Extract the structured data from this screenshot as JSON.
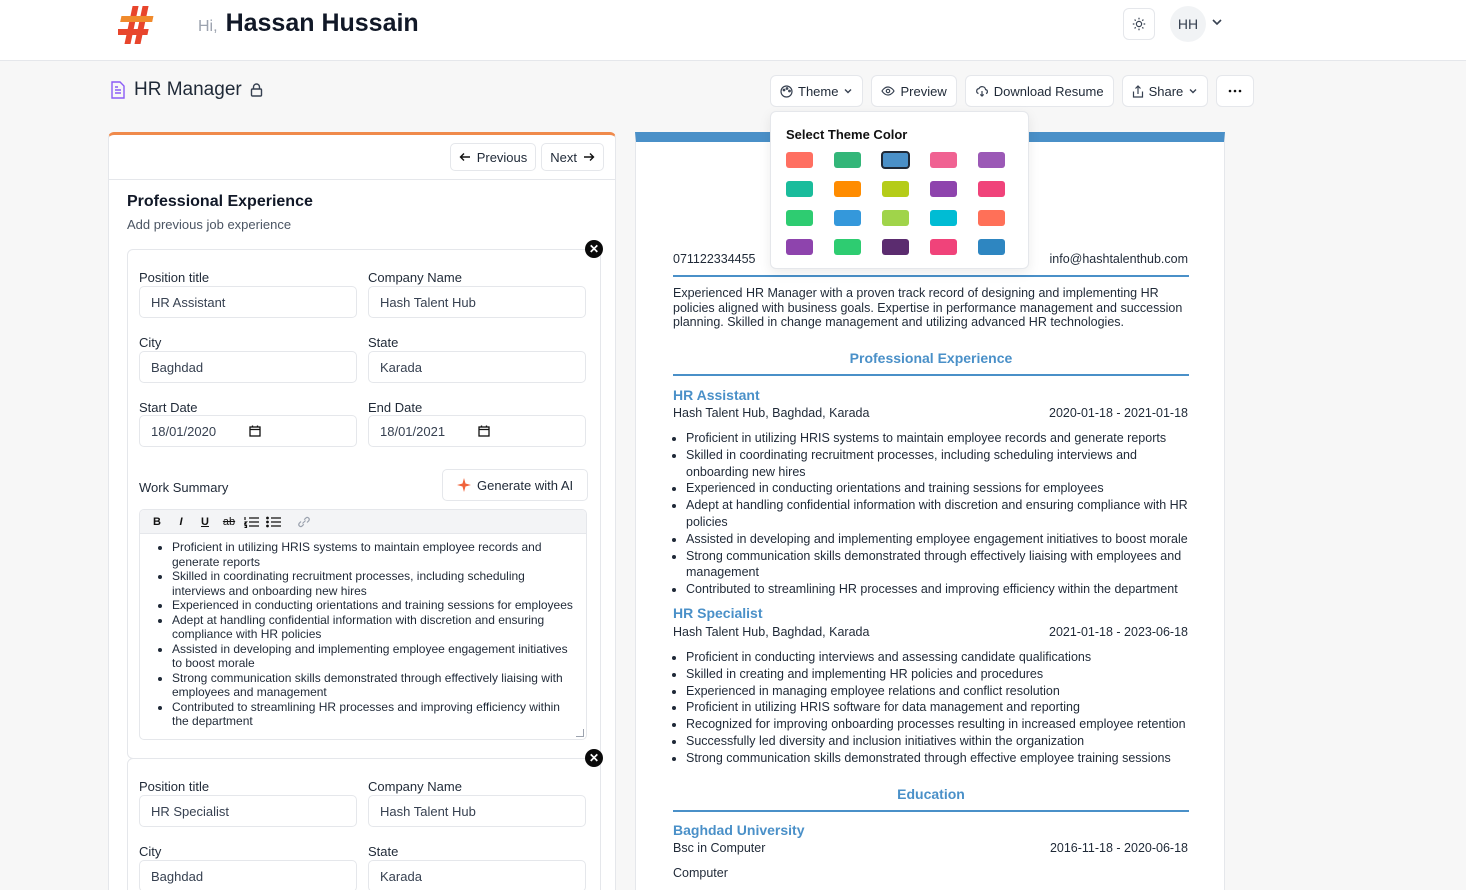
{
  "header": {
    "greeting": "Hi,",
    "user_name": "Hassan Hussain",
    "avatar_initials": "HH",
    "theme_toggle_icon": "sun-icon",
    "logo_icon": "hash-logo"
  },
  "document": {
    "title": "HR Manager",
    "lock_icon": "lock-icon"
  },
  "toolbar": {
    "theme": "Theme",
    "preview": "Preview",
    "download": "Download Resume",
    "share": "Share",
    "more_icon": "ellipsis-icon"
  },
  "theme_dropdown": {
    "title": "Select Theme Color",
    "colors": [
      "#ff6f61",
      "#33b679",
      "#4a90c8",
      "#f06292",
      "#9b59b6",
      "#1abc9c",
      "#ff8c00",
      "#b5cc18",
      "#8e44ad",
      "#f0437a",
      "#2ecc71",
      "#3498db",
      "#a0d44a",
      "#00bcd4",
      "#ff7058",
      "#8e44ad",
      "#2ecc71",
      "#5b2c6f",
      "#f0437a",
      "#2e86c1"
    ],
    "selected_index": 2
  },
  "form": {
    "previous": "Previous",
    "next": "Next",
    "section_title": "Professional Experience",
    "section_subtitle": "Add previous job experience",
    "labels": {
      "position": "Position title",
      "company": "Company Name",
      "city": "City",
      "state": "State",
      "start": "Start Date",
      "end": "End Date",
      "summary": "Work Summary",
      "generate": "Generate with AI"
    },
    "editor_toolbar": [
      "B",
      "I",
      "U",
      "ab"
    ],
    "entries": [
      {
        "position": "HR Assistant",
        "company": "Hash Talent Hub",
        "city": "Baghdad",
        "state": "Karada",
        "start": "18/01/2020",
        "end": "18/01/2021",
        "summary": [
          "Proficient in utilizing HRIS systems to maintain employee records and generate reports",
          "Skilled in coordinating recruitment processes, including scheduling interviews and onboarding new hires",
          "Experienced in conducting orientations and training sessions for employees",
          "Adept at handling confidential information with discretion and ensuring compliance with HR policies",
          "Assisted in developing and implementing employee engagement initiatives to boost morale",
          "Strong communication skills demonstrated through effectively liaising with employees and management",
          "Contributed to streamlining HR processes and improving efficiency within the department"
        ]
      },
      {
        "position": "HR Specialist",
        "company": "Hash Talent Hub",
        "city": "Baghdad",
        "state": "Karada"
      }
    ]
  },
  "resume": {
    "phone": "071122334455",
    "email": "info@hashtalenthub.com",
    "summary": "Experienced HR Manager with a proven track record of designing and implementing HR policies aligned with business goals. Expertise in performance management and succession planning. Skilled in change management and utilizing advanced HR technologies.",
    "experience_heading": "Professional Experience",
    "jobs": [
      {
        "title": "HR Assistant",
        "company_line": "Hash Talent Hub, Baghdad, Karada",
        "dates": "2020-01-18 - 2021-01-18",
        "bullets": [
          "Proficient in utilizing HRIS systems to maintain employee records and generate reports",
          "Skilled in coordinating recruitment processes, including scheduling interviews and onboarding new hires",
          "Experienced in conducting orientations and training sessions for employees",
          "Adept at handling confidential information with discretion and ensuring compliance with HR policies",
          "Assisted in developing and implementing employee engagement initiatives to boost morale",
          "Strong communication skills demonstrated through effectively liaising with employees and management",
          "Contributed to streamlining HR processes and improving efficiency within the department"
        ]
      },
      {
        "title": "HR Specialist",
        "company_line": "Hash Talent Hub, Baghdad, Karada",
        "dates": "2021-01-18 - 2023-06-18",
        "bullets": [
          "Proficient in conducting interviews and assessing candidate qualifications",
          "Skilled in creating and implementing HR policies and procedures",
          "Experienced in managing employee relations and conflict resolution",
          "Proficient in utilizing HRIS software for data management and reporting",
          "Recognized for improving onboarding processes resulting in increased employee retention",
          "Successfully led diversity and inclusion initiatives within the organization",
          "Strong communication skills demonstrated through effective employee training sessions"
        ]
      }
    ],
    "education_heading": "Education",
    "education": {
      "school": "Baghdad University",
      "degree": "Bsc in Computer",
      "dates": "2016-11-18 - 2020-06-18",
      "major": "Computer"
    }
  }
}
